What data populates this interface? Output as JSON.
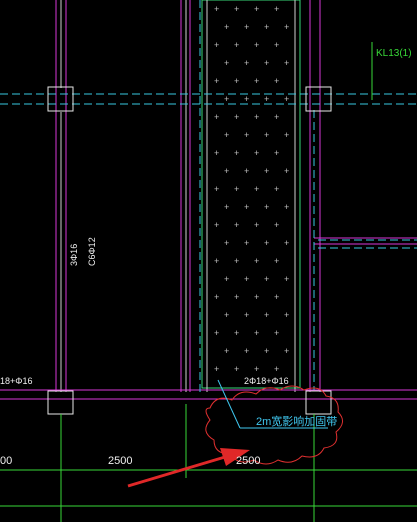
{
  "colors": {
    "background": "#000000",
    "beam": "#d838d8",
    "dashed_axis": "#38c8e0",
    "column": "#e8e8e8",
    "hatch_border": "#38d878",
    "dim_line": "#38d838",
    "annotation_white": "#f0f0f0",
    "annotation_green": "#38d838",
    "annotation_cyan": "#40c8f0",
    "cloud": "#e03030",
    "arrow": "#e02828"
  },
  "annotations": {
    "beam_label": "KL13(1)",
    "vertical_rebar_top": "3Φ16",
    "vertical_rebar_bottom": "C6Φ12",
    "left_rebar": "18+Φ16",
    "center_rebar": "2Φ18+Φ16",
    "backfill_note": "2m宽影响加固带"
  },
  "dimensions": {
    "left_partial": "00",
    "center": "2500",
    "right_partial": "2500"
  },
  "hatch_symbol": "+"
}
